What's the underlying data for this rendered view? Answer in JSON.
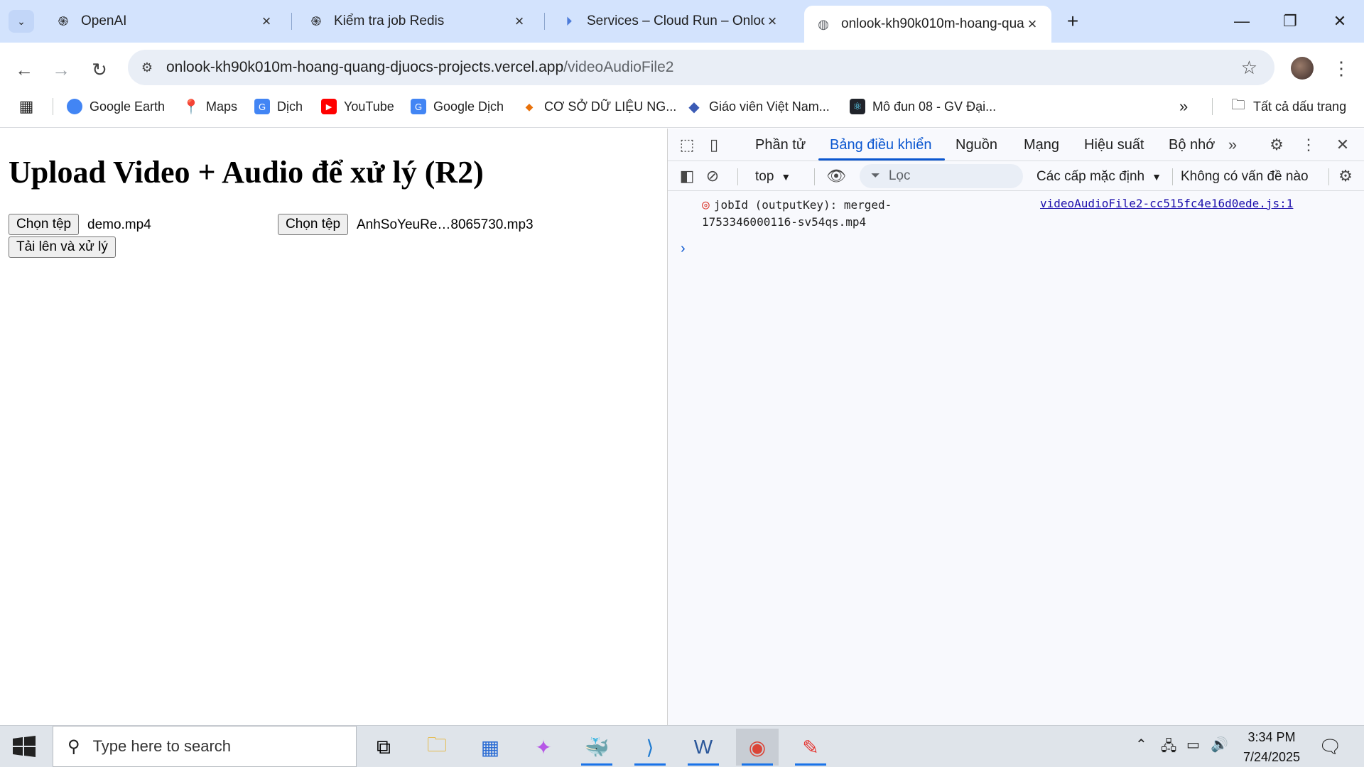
{
  "browser": {
    "tabs": [
      {
        "title": "OpenAI",
        "icon": "openai-icon"
      },
      {
        "title": "Kiểm tra job Redis",
        "icon": "openai-icon"
      },
      {
        "title": "Services – Cloud Run – Onlook",
        "icon": "cloud-run-icon"
      },
      {
        "title": "onlook-kh90k010m-hoang-qua",
        "icon": "globe-icon",
        "active": true
      }
    ],
    "url_host": "onlook-kh90k010m-hoang-quang-djuocs-projects.vercel.app",
    "url_path": "/videoAudioFile2",
    "bookmarks": [
      {
        "label": "Google Earth",
        "icon": "google-earth-icon"
      },
      {
        "label": "Maps",
        "icon": "maps-icon"
      },
      {
        "label": "Dịch",
        "icon": "translate-icon"
      },
      {
        "label": "YouTube",
        "icon": "youtube-icon"
      },
      {
        "label": "Google Dịch",
        "icon": "translate-icon"
      },
      {
        "label": "CƠ SỞ DỮ LIỆU NG...",
        "icon": "diamond-icon"
      },
      {
        "label": "Giáo viên Việt Nam...",
        "icon": "diamond-icon"
      },
      {
        "label": "Mô đun 08 - GV Đại...",
        "icon": "react-icon"
      }
    ],
    "all_bookmarks": "Tất cả dấu trang"
  },
  "page": {
    "title": "Upload Video + Audio để xử lý (R2)",
    "choose_file_label": "Chọn tệp",
    "video_file": "demo.mp4",
    "audio_file": "AnhSoYeuRe…8065730.mp3",
    "upload_button": "Tải lên và xử lý"
  },
  "devtools": {
    "tabs": [
      "Phần tử",
      "Bảng điều khiển",
      "Nguồn",
      "Mạng",
      "Hiệu suất",
      "Bộ nhớ"
    ],
    "active_tab": "Bảng điều khiển",
    "context": "top",
    "filter_placeholder": "Lọc",
    "levels": "Các cấp mặc định",
    "issues": "Không có vấn đề nào",
    "log_line1": "jobId (outputKey): merged-",
    "log_line2": "1753346000116-sv54qs.mp4",
    "log_source": "videoAudioFile2-cc515fc4e16d0ede.js:1"
  },
  "taskbar": {
    "search_placeholder": "Type here to search",
    "time": "3:34 PM",
    "date": "7/24/2025"
  }
}
